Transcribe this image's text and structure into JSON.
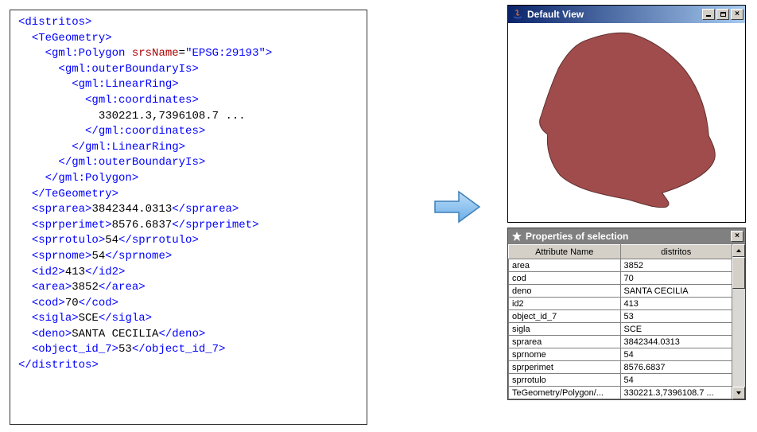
{
  "xml": {
    "root": "distritos",
    "te": "TeGeometry",
    "polygon": "gml:Polygon",
    "srs_attr": "srsName",
    "srs_val": "\"EPSG:29193\"",
    "outer": "gml:outerBoundaryIs",
    "ring": "gml:LinearRing",
    "coords": "gml:coordinates",
    "coord_text": "330221.3,7396108.7 ...",
    "fields": {
      "sprarea": "3842344.0313",
      "sprperimet": "8576.6837",
      "sprrotulo": "54",
      "sprnome": "54",
      "id2": "413",
      "area": "3852",
      "cod": "70",
      "sigla": "SCE",
      "deno": "SANTA CECILIA",
      "object_id_7": "53"
    }
  },
  "view_window": {
    "title": "Default View"
  },
  "props": {
    "title": "Properties of selection",
    "col1": "Attribute Name",
    "col2": "distritos",
    "rows": [
      {
        "attr": "area",
        "val": "3852"
      },
      {
        "attr": "cod",
        "val": "70"
      },
      {
        "attr": "deno",
        "val": "SANTA CECILIA"
      },
      {
        "attr": "id2",
        "val": "413"
      },
      {
        "attr": "object_id_7",
        "val": "53"
      },
      {
        "attr": "sigla",
        "val": "SCE"
      },
      {
        "attr": "sprarea",
        "val": "3842344.0313"
      },
      {
        "attr": "sprnome",
        "val": "54"
      },
      {
        "attr": "sprperimet",
        "val": "8576.6837"
      },
      {
        "attr": "sprrotulo",
        "val": "54"
      },
      {
        "attr": "TeGeometry/Polygon/...",
        "val": "330221.3,7396108.7 ..."
      }
    ]
  },
  "colors": {
    "polygon_fill": "#a04c4c",
    "polygon_stroke": "#5e2e2e"
  }
}
